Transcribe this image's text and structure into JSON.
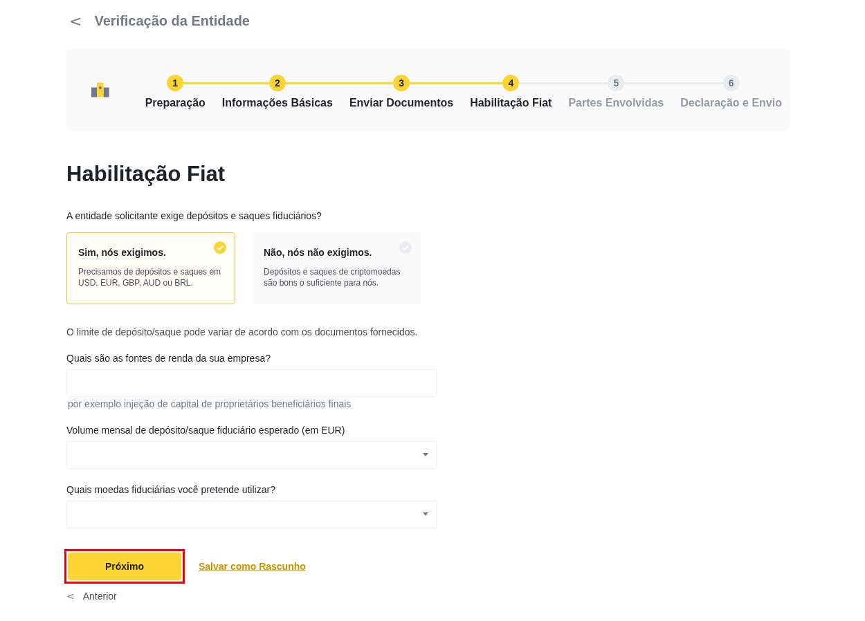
{
  "header": {
    "back_icon": "<",
    "title": "Verificação da Entidade"
  },
  "steps": [
    {
      "number": "1",
      "label": "Preparação",
      "done": true
    },
    {
      "number": "2",
      "label": "Informações Básicas",
      "done": true
    },
    {
      "number": "3",
      "label": "Enviar Documentos",
      "done": true
    },
    {
      "number": "4",
      "label": "Habilitação Fiat",
      "done": true
    },
    {
      "number": "5",
      "label": "Partes Envolvidas",
      "done": false
    },
    {
      "number": "6",
      "label": "Declaração e Envio",
      "done": false
    }
  ],
  "heading": "Habilitação Fiat",
  "question": "A entidade solicitante exige depósitos e saques fiduciários?",
  "options": [
    {
      "title": "Sim, nós exigimos.",
      "description": "Precisamos de depósitos e saques em USD, EUR, GBP, AUD ou BRL.",
      "selected": true
    },
    {
      "title": "Não, nós não exigimos.",
      "description": "Depósitos e saques de criptomoedas são bons o suficiente para nós.",
      "selected": false
    }
  ],
  "note": "O limite de depósito/saque pode variar de acordo com os documentos fornecidos.",
  "fields": [
    {
      "kind": "text",
      "label": "Quais são as fontes de renda da sua empresa?",
      "hint": "por exemplo injeção de capital de proprietários beneficiários finais"
    },
    {
      "kind": "select",
      "label": "Volume mensal de depósito/saque fiduciário esperado (em EUR)"
    },
    {
      "kind": "select",
      "label": "Quais moedas fiduciárias você pretende utilizar?"
    }
  ],
  "next_button": {
    "label": "Próximo",
    "highlighted": true
  },
  "draft_link": "Salvar como Rascunho",
  "previous": {
    "icon": "<",
    "label": "Anterior"
  }
}
